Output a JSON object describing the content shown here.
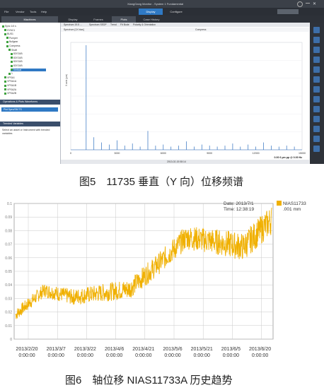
{
  "figure1": {
    "window_title": "XiangGang Monitor - System 1 Fundamental",
    "menu": [
      "File",
      "Vendor",
      "Tools",
      "Help"
    ],
    "mode_buttons": [
      "Display",
      "Configure"
    ],
    "panel_tabs": [
      "Machines",
      "Display",
      "Frames",
      "Plots",
      "Case History"
    ],
    "panel_title": "Machines",
    "tree": [
      "Sync 1/4 s",
      "SYNC1",
      "BUS1",
      "Pumper",
      "Bullgear",
      "Compress",
      "Shaft",
      "83Y2UB",
      "83Y2UB",
      "83Y2UB",
      "83Y2UB",
      "Vertical",
      "1",
      "VPSA1",
      "VPSA1A",
      "VPSA1B",
      "VPSA2A",
      "VPSA2B"
    ],
    "section_ops": "Operations & Plots Waveforms",
    "section_ops_item": "Plot Spec/SM TS",
    "section_trended": "Trended Variables",
    "trended_note": "Select an asset or Instrument with trended variables",
    "plot_toolbar": [
      "Spectrum 19.5 ...",
      "Spectrum SEDP",
      "Trend",
      "Fit Bode",
      "Polarity & Orientation"
    ],
    "plot_header": "Spectrum [1X bias]",
    "plot_header_right": "Compress",
    "ylabel": "X axis (µm)",
    "xticks": [
      "0",
      "3000",
      "6000",
      "9000",
      "12000",
      "15000"
    ],
    "readout": "0.00 6 µm pp @ 0.00 Hz",
    "footer_time": "2013-02-15 08:14"
  },
  "caption1": "图5　11735 垂直（Y 向）位移频谱",
  "figure2": {
    "legend_label": "NIAS11733",
    "legend_unit": ".001  mm",
    "date_label": "Date: 2013/7/1",
    "time_label": "Time: 12:38:19",
    "ytick_labels": [
      "0.1",
      "0.09",
      "0.08",
      "0.07",
      "0.06",
      "0.05",
      "0.04",
      "0.03",
      "0.02",
      "0.01",
      "0"
    ],
    "xtick_dates": [
      "2013/2/20",
      "2013/3/7",
      "2013/3/22",
      "2013/4/6",
      "2013/4/21",
      "2013/5/6",
      "2013/5/21",
      "2013/6/5",
      "2013/6/20"
    ],
    "xtick_time": "0:00:00",
    "line_color": "#f0b000"
  },
  "caption2": "图6　轴位移 NIAS11733A 历史趋势",
  "chart_data": [
    {
      "type": "bar",
      "xlabel": "",
      "ylabel": "X axis (µm)",
      "xlim": [
        0,
        15000
      ],
      "xticks": [
        0,
        3000,
        6000,
        9000,
        12000,
        15000
      ],
      "peaks_x": [
        1000,
        1500,
        2000,
        2500,
        3000,
        3500,
        4000,
        4500,
        5000,
        5500,
        6000,
        6500,
        7000,
        7500,
        8000,
        8500,
        9000,
        9500,
        10000,
        10500,
        11000,
        11500,
        12000,
        12500,
        13000,
        13500,
        14000,
        14500
      ],
      "peaks_y": [
        1.0,
        0.12,
        0.07,
        0.05,
        0.09,
        0.04,
        0.06,
        0.03,
        0.18,
        0.04,
        0.05,
        0.03,
        0.04,
        0.08,
        0.03,
        0.05,
        0.04,
        0.03,
        0.04,
        0.06,
        0.03,
        0.05,
        0.03,
        0.07,
        0.04,
        0.03,
        0.04,
        0.03
      ]
    },
    {
      "type": "line",
      "title": "",
      "series": [
        {
          "name": "NIAS11733",
          "color": "#f0b000"
        }
      ],
      "x_dates": [
        "2013/2/20",
        "2013/3/7",
        "2013/3/22",
        "2013/4/6",
        "2013/4/21",
        "2013/5/6",
        "2013/5/21",
        "2013/6/5",
        "2013/6/20",
        "2013/7/1"
      ],
      "y_values": [
        0.018,
        0.036,
        0.031,
        0.034,
        0.037,
        0.055,
        0.075,
        0.072,
        0.068,
        0.088
      ],
      "ylim": [
        0,
        0.1
      ]
    }
  ]
}
